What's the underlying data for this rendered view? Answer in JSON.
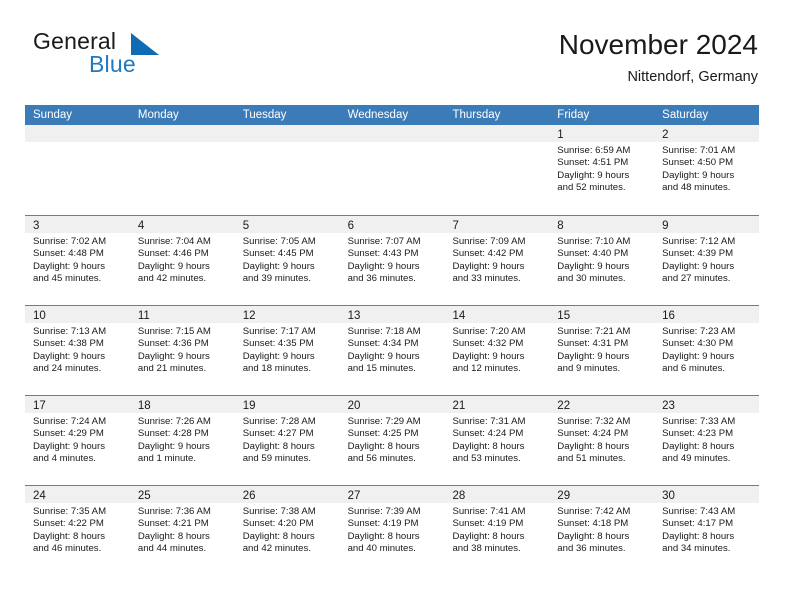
{
  "brand": {
    "name_part1": "General",
    "name_part2": "Blue",
    "triangle_color": "#0f6cb4",
    "blue_text_color": "#2079c3"
  },
  "header": {
    "title": "November 2024",
    "location": "Nittendorf, Germany"
  },
  "theme": {
    "header_band": "#3b7cb8",
    "day_strip": "#f0f0f0",
    "row_divider": "#4a86bf",
    "text": "#1a1a1a"
  },
  "weekdays": [
    "Sunday",
    "Monday",
    "Tuesday",
    "Wednesday",
    "Thursday",
    "Friday",
    "Saturday"
  ],
  "weeks": [
    [
      {
        "day": "",
        "lines": []
      },
      {
        "day": "",
        "lines": []
      },
      {
        "day": "",
        "lines": []
      },
      {
        "day": "",
        "lines": []
      },
      {
        "day": "",
        "lines": []
      },
      {
        "day": "1",
        "lines": [
          "Sunrise: 6:59 AM",
          "Sunset: 4:51 PM",
          "Daylight: 9 hours",
          "and 52 minutes."
        ]
      },
      {
        "day": "2",
        "lines": [
          "Sunrise: 7:01 AM",
          "Sunset: 4:50 PM",
          "Daylight: 9 hours",
          "and 48 minutes."
        ]
      }
    ],
    [
      {
        "day": "3",
        "lines": [
          "Sunrise: 7:02 AM",
          "Sunset: 4:48 PM",
          "Daylight: 9 hours",
          "and 45 minutes."
        ]
      },
      {
        "day": "4",
        "lines": [
          "Sunrise: 7:04 AM",
          "Sunset: 4:46 PM",
          "Daylight: 9 hours",
          "and 42 minutes."
        ]
      },
      {
        "day": "5",
        "lines": [
          "Sunrise: 7:05 AM",
          "Sunset: 4:45 PM",
          "Daylight: 9 hours",
          "and 39 minutes."
        ]
      },
      {
        "day": "6",
        "lines": [
          "Sunrise: 7:07 AM",
          "Sunset: 4:43 PM",
          "Daylight: 9 hours",
          "and 36 minutes."
        ]
      },
      {
        "day": "7",
        "lines": [
          "Sunrise: 7:09 AM",
          "Sunset: 4:42 PM",
          "Daylight: 9 hours",
          "and 33 minutes."
        ]
      },
      {
        "day": "8",
        "lines": [
          "Sunrise: 7:10 AM",
          "Sunset: 4:40 PM",
          "Daylight: 9 hours",
          "and 30 minutes."
        ]
      },
      {
        "day": "9",
        "lines": [
          "Sunrise: 7:12 AM",
          "Sunset: 4:39 PM",
          "Daylight: 9 hours",
          "and 27 minutes."
        ]
      }
    ],
    [
      {
        "day": "10",
        "lines": [
          "Sunrise: 7:13 AM",
          "Sunset: 4:38 PM",
          "Daylight: 9 hours",
          "and 24 minutes."
        ]
      },
      {
        "day": "11",
        "lines": [
          "Sunrise: 7:15 AM",
          "Sunset: 4:36 PM",
          "Daylight: 9 hours",
          "and 21 minutes."
        ]
      },
      {
        "day": "12",
        "lines": [
          "Sunrise: 7:17 AM",
          "Sunset: 4:35 PM",
          "Daylight: 9 hours",
          "and 18 minutes."
        ]
      },
      {
        "day": "13",
        "lines": [
          "Sunrise: 7:18 AM",
          "Sunset: 4:34 PM",
          "Daylight: 9 hours",
          "and 15 minutes."
        ]
      },
      {
        "day": "14",
        "lines": [
          "Sunrise: 7:20 AM",
          "Sunset: 4:32 PM",
          "Daylight: 9 hours",
          "and 12 minutes."
        ]
      },
      {
        "day": "15",
        "lines": [
          "Sunrise: 7:21 AM",
          "Sunset: 4:31 PM",
          "Daylight: 9 hours",
          "and 9 minutes."
        ]
      },
      {
        "day": "16",
        "lines": [
          "Sunrise: 7:23 AM",
          "Sunset: 4:30 PM",
          "Daylight: 9 hours",
          "and 6 minutes."
        ]
      }
    ],
    [
      {
        "day": "17",
        "lines": [
          "Sunrise: 7:24 AM",
          "Sunset: 4:29 PM",
          "Daylight: 9 hours",
          "and 4 minutes."
        ]
      },
      {
        "day": "18",
        "lines": [
          "Sunrise: 7:26 AM",
          "Sunset: 4:28 PM",
          "Daylight: 9 hours",
          "and 1 minute."
        ]
      },
      {
        "day": "19",
        "lines": [
          "Sunrise: 7:28 AM",
          "Sunset: 4:27 PM",
          "Daylight: 8 hours",
          "and 59 minutes."
        ]
      },
      {
        "day": "20",
        "lines": [
          "Sunrise: 7:29 AM",
          "Sunset: 4:25 PM",
          "Daylight: 8 hours",
          "and 56 minutes."
        ]
      },
      {
        "day": "21",
        "lines": [
          "Sunrise: 7:31 AM",
          "Sunset: 4:24 PM",
          "Daylight: 8 hours",
          "and 53 minutes."
        ]
      },
      {
        "day": "22",
        "lines": [
          "Sunrise: 7:32 AM",
          "Sunset: 4:24 PM",
          "Daylight: 8 hours",
          "and 51 minutes."
        ]
      },
      {
        "day": "23",
        "lines": [
          "Sunrise: 7:33 AM",
          "Sunset: 4:23 PM",
          "Daylight: 8 hours",
          "and 49 minutes."
        ]
      }
    ],
    [
      {
        "day": "24",
        "lines": [
          "Sunrise: 7:35 AM",
          "Sunset: 4:22 PM",
          "Daylight: 8 hours",
          "and 46 minutes."
        ]
      },
      {
        "day": "25",
        "lines": [
          "Sunrise: 7:36 AM",
          "Sunset: 4:21 PM",
          "Daylight: 8 hours",
          "and 44 minutes."
        ]
      },
      {
        "day": "26",
        "lines": [
          "Sunrise: 7:38 AM",
          "Sunset: 4:20 PM",
          "Daylight: 8 hours",
          "and 42 minutes."
        ]
      },
      {
        "day": "27",
        "lines": [
          "Sunrise: 7:39 AM",
          "Sunset: 4:19 PM",
          "Daylight: 8 hours",
          "and 40 minutes."
        ]
      },
      {
        "day": "28",
        "lines": [
          "Sunrise: 7:41 AM",
          "Sunset: 4:19 PM",
          "Daylight: 8 hours",
          "and 38 minutes."
        ]
      },
      {
        "day": "29",
        "lines": [
          "Sunrise: 7:42 AM",
          "Sunset: 4:18 PM",
          "Daylight: 8 hours",
          "and 36 minutes."
        ]
      },
      {
        "day": "30",
        "lines": [
          "Sunrise: 7:43 AM",
          "Sunset: 4:17 PM",
          "Daylight: 8 hours",
          "and 34 minutes."
        ]
      }
    ]
  ]
}
